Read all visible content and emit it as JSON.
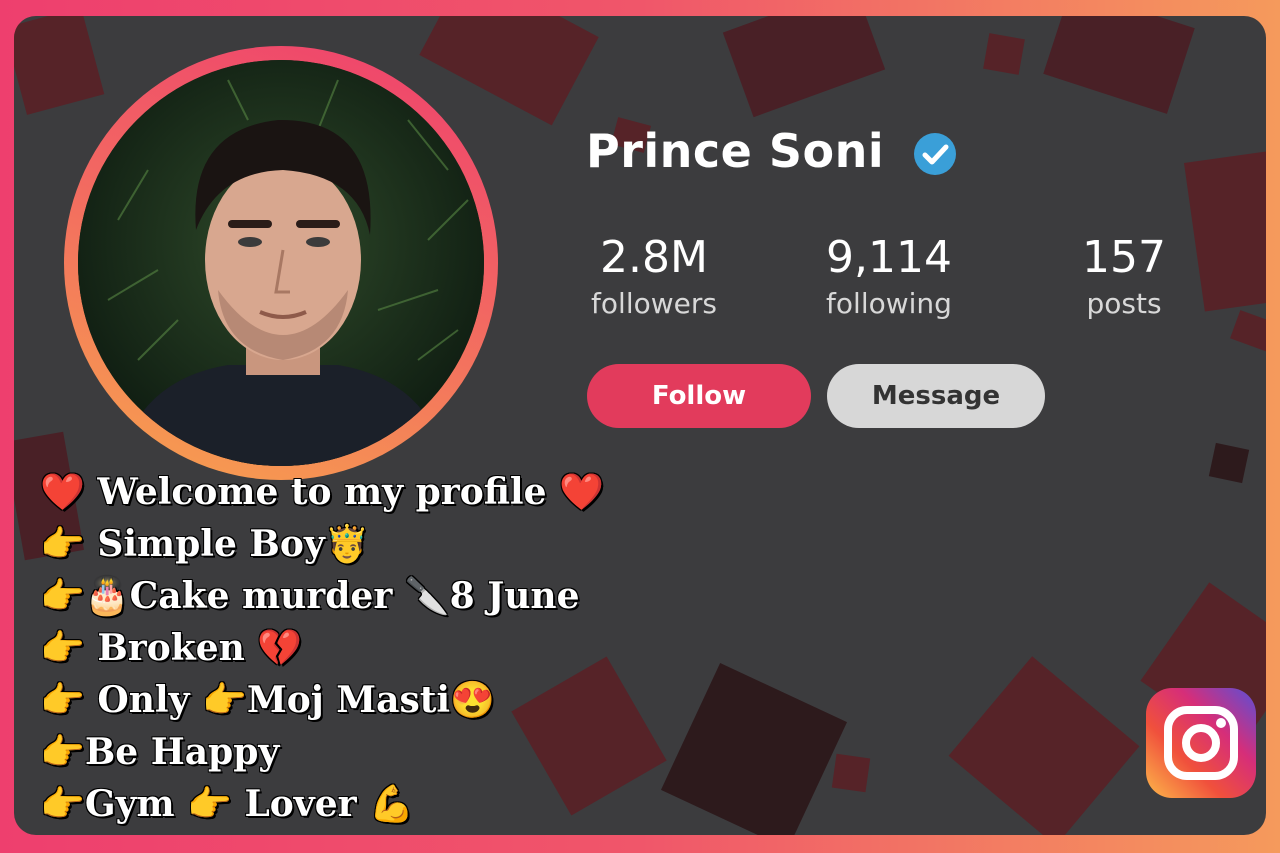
{
  "profile": {
    "name": "Prince Soni",
    "verified_icon": "verified-badge-icon"
  },
  "stats": [
    {
      "value": "2.8M",
      "label": "followers"
    },
    {
      "value": "9,114",
      "label": "following"
    },
    {
      "value": "157",
      "label": "posts"
    }
  ],
  "actions": {
    "follow_label": "Follow",
    "message_label": "Message"
  },
  "bio": [
    "❤️ Welcome to my profile ❤️",
    "👉 Simple Boy🤴",
    "👉🎂Cake murder 🔪8 June",
    "👉 Broken 💔",
    "👉 Only 👉Moj Masti😍",
    "👉Be Happy",
    "👉Gym 👉 Lover 💪"
  ],
  "colors": {
    "accent": "#e23b5c",
    "frame_gradient_start": "#ee3f6e",
    "frame_gradient_end": "#f59a5c",
    "background": "#3c3c3e",
    "verified": "#3a9fd8"
  },
  "icons": [
    "verified-badge-icon",
    "instagram-logo-icon"
  ]
}
